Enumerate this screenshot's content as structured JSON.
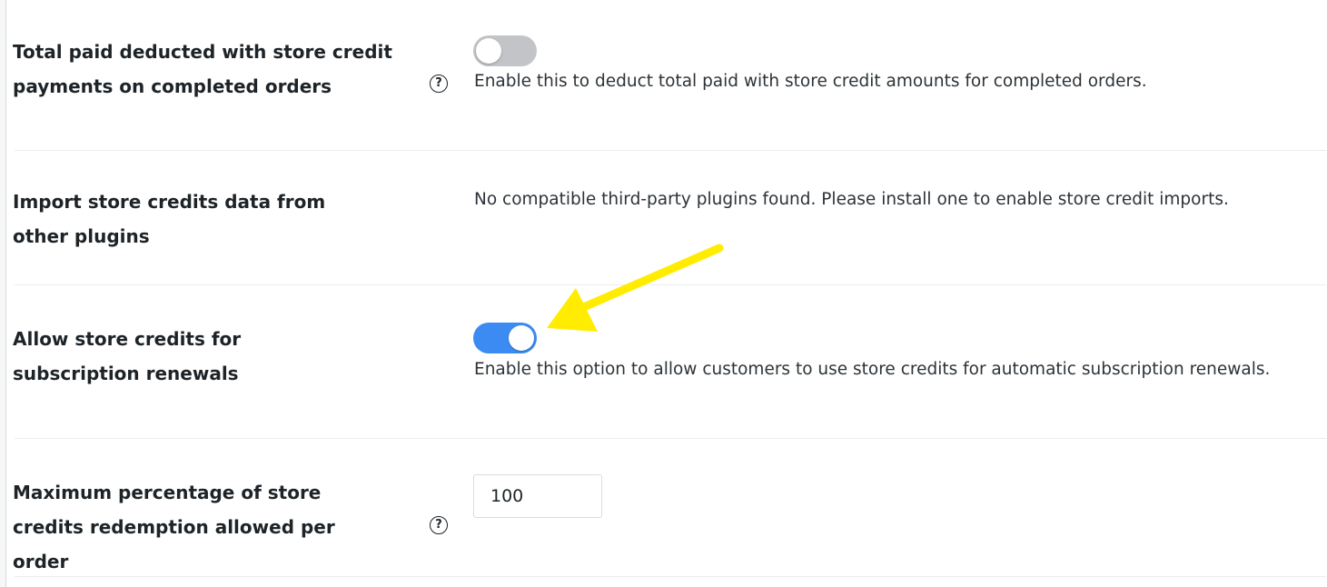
{
  "settings": {
    "deduct_total_paid": {
      "label": "Total paid deducted with store credit payments on completed orders",
      "description": "Enable this to deduct total paid with store credit amounts for completed orders.",
      "enabled": false
    },
    "import_store_credits": {
      "label": "Import store credits data from other plugins",
      "description": "No compatible third-party plugins found. Please install one to enable store credit imports."
    },
    "subscription_renewals": {
      "label": "Allow store credits for subscription renewals",
      "description": "Enable this option to allow customers to use store credits for automatic subscription renewals.",
      "enabled": true
    },
    "max_percentage": {
      "label": "Maximum percentage of store credits redemption allowed per order",
      "value": "100"
    }
  },
  "help_icon_glyph": "?",
  "colors": {
    "toggle_on": "#3c8bf3",
    "toggle_off": "#c3c4c7",
    "arrow": "#ffec00"
  }
}
